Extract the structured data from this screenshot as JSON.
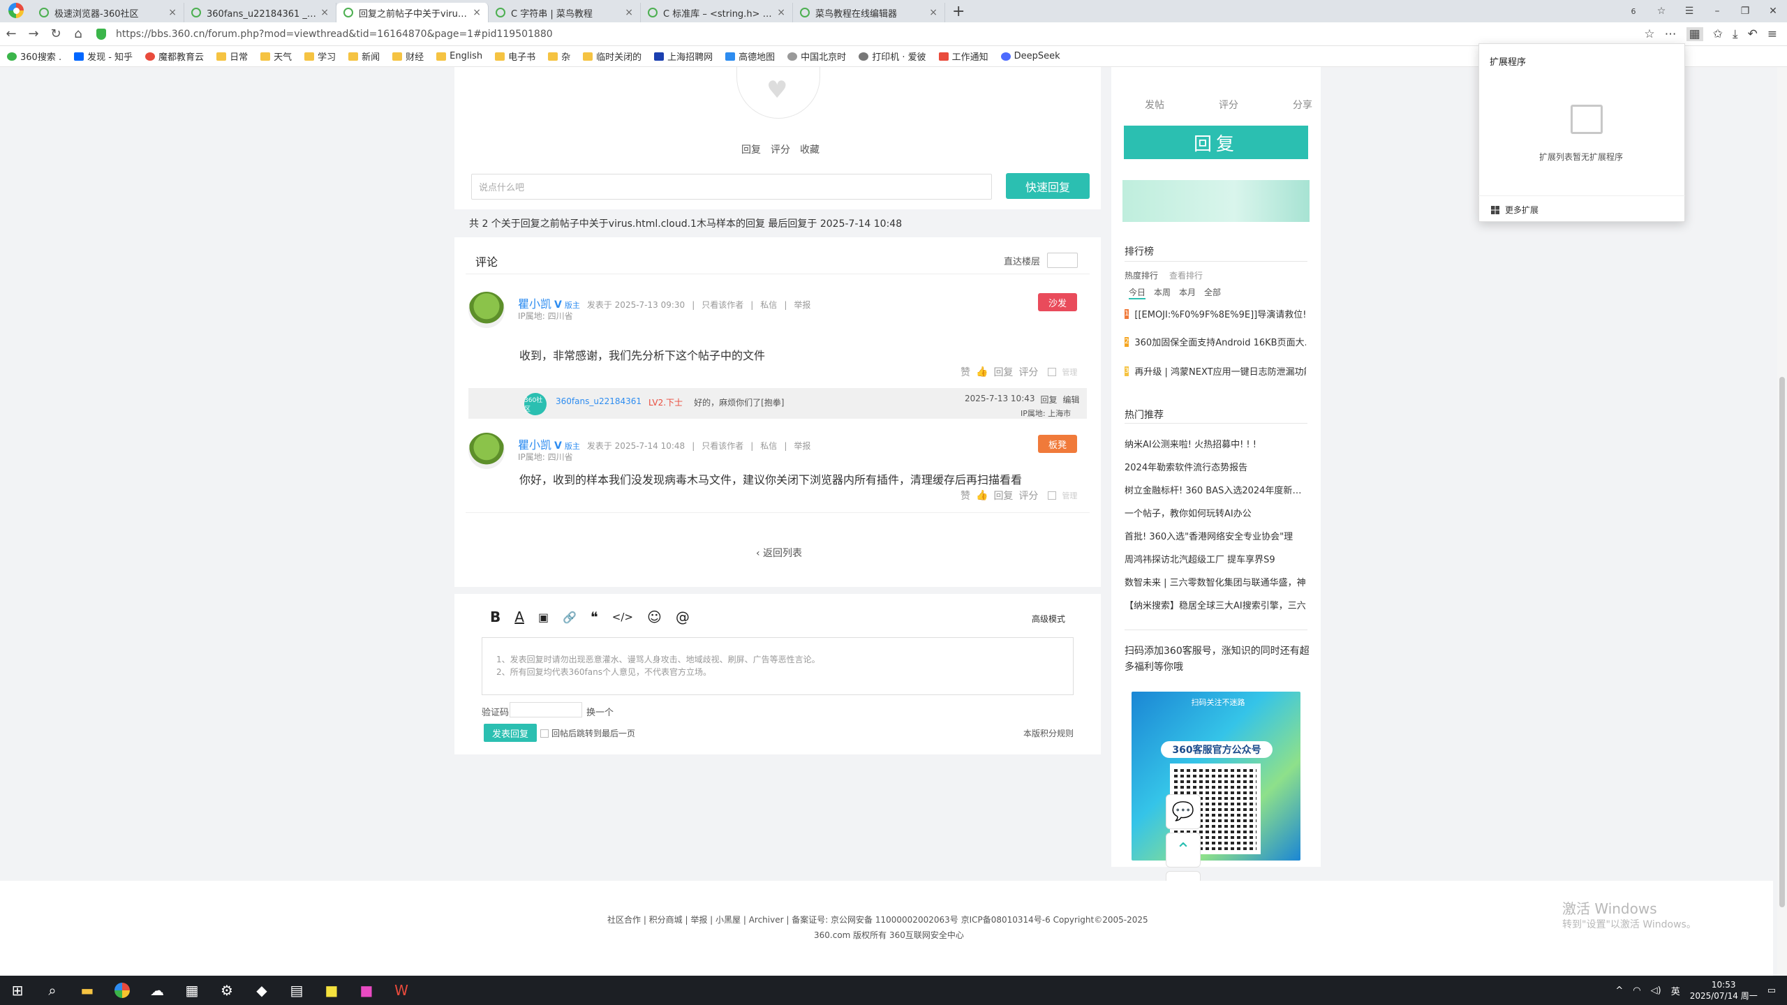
{
  "tabs": [
    {
      "title": "极速浏览器-360社区"
    },
    {
      "title": "360fans_u22184361 _360社"
    },
    {
      "title": "回复之前帖子中关于virus.html"
    },
    {
      "title": "C 字符串 | 菜鸟教程"
    },
    {
      "title": "C 标准库 – <string.h> | 菜鸟"
    },
    {
      "title": "菜鸟教程在线编辑器"
    }
  ],
  "tab_close": "×",
  "new_tab": "+",
  "window": {
    "tab_count": "6"
  },
  "address": {
    "url": "https://bbs.360.cn/forum.php?mod=viewthread&tid=16164870&page=1#pid119501880"
  },
  "bookmarks": [
    "360搜索 . ",
    "发现 - 知乎",
    "魔都教育云",
    "日常",
    "天气",
    "学习",
    "新闻",
    "财经",
    "English",
    "电子书",
    "杂",
    "临时关闭的",
    "上海招聘网",
    "高德地图",
    "中国北京时",
    "打印机 · 爱彼",
    "工作通知",
    "DeepSeek"
  ],
  "post_actions_top": {
    "reply": "回复",
    "rate": "评分",
    "fav": "收藏"
  },
  "quick_reply": {
    "placeholder": "说点什么吧",
    "button": "快速回复"
  },
  "summary": "共 2 个关于回复之前帖子中关于virus.html.cloud.1木马样本的回复 最后回复于 2025-7-14 10:48",
  "comments": {
    "title": "评论",
    "jump_label": "直达楼层"
  },
  "posts": [
    {
      "user": "瞿小凯",
      "v": "V",
      "role": "版主",
      "time": "发表于 2025-7-13 09:30",
      "only_author": "只看该作者",
      "pm": "私信",
      "report": "举报",
      "ip": "IP属地: 四川省",
      "badge": "沙发",
      "badge_color": "#e94b5b",
      "text": "收到，非常感谢，我们先分析下这个帖子中的文件",
      "like": "赞",
      "reply": "回复",
      "rate": "评分",
      "manage": "管理"
    },
    {
      "user": "瞿小凯",
      "v": "V",
      "role": "版主",
      "time": "发表于 2025-7-14 10:48",
      "only_author": "只看该作者",
      "pm": "私信",
      "report": "举报",
      "ip": "IP属地: 四川省",
      "badge": "板凳",
      "badge_color": "#f07a3a",
      "text": "你好，收到的样本我们没发现病毒木马文件，建议你关闭下浏览器内所有插件，清理缓存后再扫描看看",
      "like": "赞",
      "reply": "回复",
      "rate": "评分",
      "manage": "管理"
    }
  ],
  "sub_reply": {
    "avatar_text": "360社区",
    "user": "360fans_u22184361",
    "level": "LV2.下士",
    "text": "好的，麻烦你们了[抱拳]",
    "time": "2025-7-13 10:43",
    "reply": "回复",
    "edit": "编辑",
    "ip": "IP属地: 上海市"
  },
  "back_to_list": "‹ 返回列表",
  "editor": {
    "advanced": "高级模式",
    "tip1": "1、发表回复时请勿出现恶意灌水、谩骂人身攻击、地域歧视、刷屏、广告等恶性言论。",
    "tip2": "2、所有回复均代表360fans个人意见，不代表官方立场。",
    "captcha_label": "验证码",
    "swap": "换一个",
    "post_button": "发表回复",
    "after_post": "回帖后跳转到最后一页",
    "rules": "本版积分规则"
  },
  "right": {
    "tabs": [
      "发帖",
      "评分",
      "分享"
    ],
    "reply_big": "回复",
    "rank_title": "排行榜",
    "rank_tabs": [
      "热度排行",
      "查看排行"
    ],
    "rank_periods": [
      "今日",
      "本周",
      "本月",
      "全部"
    ],
    "rank_items": [
      {
        "n": "1",
        "text": "[[EMOJI:%F0%9F%8E%9E]]导演请救位! ..."
      },
      {
        "n": "2",
        "text": "360加固保全面支持Android 16KB页面大..."
      },
      {
        "n": "3",
        "text": "再升级 | 鸿蒙NEXT应用一键日志防泄漏功能"
      }
    ],
    "hot_title": "热门推荐",
    "hot_items": [
      "纳米AI公测来啦! 火热招募中! ! !",
      "2024年勒索软件流行态势报告",
      "树立金融标杆! 360 BAS入选2024年度新一代",
      "一个帖子，教你如何玩转AI办公",
      "首批! 360入选\"香港网络安全专业协会\"理",
      "周鸿祎探访北汽超级工厂 提车享界S9",
      "数智未来 | 三六零数智化集团与联通华盛，神",
      "【纳米搜索】稳居全球三大AI搜索引擎，三六"
    ],
    "qr_text": "扫码添加360客服号，涨知识的同时还有超多福利等你哦",
    "qr_top": "扫码关注不迷路",
    "qr_title": "360客服官方公众号"
  },
  "ext_popup": {
    "title": "扩展程序",
    "empty": "扩展列表暂无扩展程序",
    "more": "更多扩展"
  },
  "footer": {
    "line1": "社区合作 | 积分商城 | 举报 | 小黑屋 | Archiver | 备案证号: 京公网安备 11000002002063号 京ICP备08010314号-6 Copyright©2005-2025",
    "line2": "360.com 版权所有 360互联网安全中心"
  },
  "watermark": {
    "title": "激活 Windows",
    "sub": "转到\"设置\"以激活 Windows。"
  },
  "taskbar": {
    "ime": "英",
    "time": "10:53",
    "date": "2025/07/14 周一"
  }
}
